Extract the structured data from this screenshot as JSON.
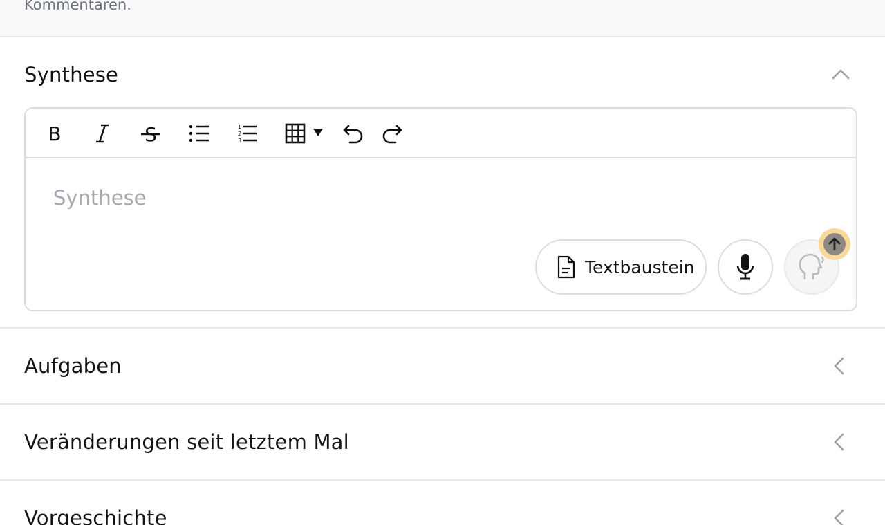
{
  "top_strip": {
    "text": "Kommentaren."
  },
  "synthese": {
    "title": "Synthese",
    "editor": {
      "placeholder": "Synthese",
      "toolbar": [
        "bold",
        "italic",
        "strikethrough",
        "bullet-list",
        "numbered-list",
        "table",
        "undo",
        "redo"
      ],
      "actions": {
        "textbaustein_label": "Textbaustein"
      }
    }
  },
  "sections": [
    {
      "title": "Aufgaben"
    },
    {
      "title": "Veränderungen seit letztem Mal"
    },
    {
      "title": "Vorgeschichte"
    }
  ],
  "colors": {
    "border": "#dadde2",
    "placeholder": "#a7abb1",
    "badge_ring": "#f8d99b",
    "badge_fill": "#8e8a83"
  }
}
